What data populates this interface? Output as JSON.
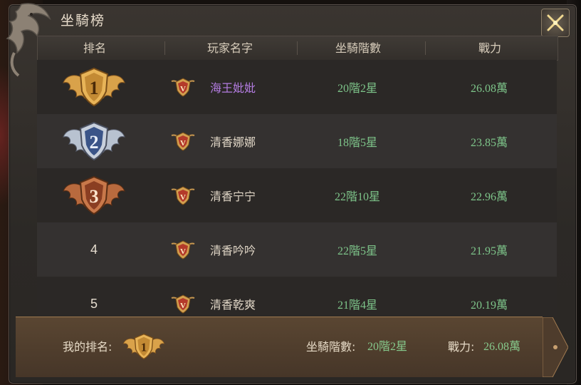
{
  "window": {
    "title": "坐騎榜"
  },
  "header": {
    "col_rank": "排名",
    "col_name": "玩家名字",
    "col_mount": "坐騎階數",
    "col_power": "戰力"
  },
  "rows": [
    {
      "rank": "1",
      "name": "海王妣妣",
      "mount": "20階2星",
      "power": "26.08萬",
      "highlight": true
    },
    {
      "rank": "2",
      "name": "清香娜娜",
      "mount": "18階5星",
      "power": "23.85萬"
    },
    {
      "rank": "3",
      "name": "清香宁宁",
      "mount": "22階10星",
      "power": "22.96萬"
    },
    {
      "rank": "4",
      "name": "清香吟吟",
      "mount": "22階5星",
      "power": "21.95萬"
    },
    {
      "rank": "5",
      "name": "清香乾爽",
      "mount": "21階4星",
      "power": "20.19萬"
    }
  ],
  "vip_badge_letter": "V",
  "footer": {
    "my_rank_label": "我的排名:",
    "my_rank": "1",
    "mount_label": "坐騎階數:",
    "mount_value": "20階2星",
    "power_label": "戰力:",
    "power_value": "26.08萬"
  },
  "colors": {
    "name_highlight": "#b37ce0",
    "value_green": "#7ec58a",
    "gold": "#d9a24a",
    "silver": "#a8b4c8",
    "bronze": "#b86a3e"
  },
  "icons": {
    "close": "close-icon",
    "rank_badge": "winged-shield-badge",
    "vip": "vip-shield-icon"
  }
}
